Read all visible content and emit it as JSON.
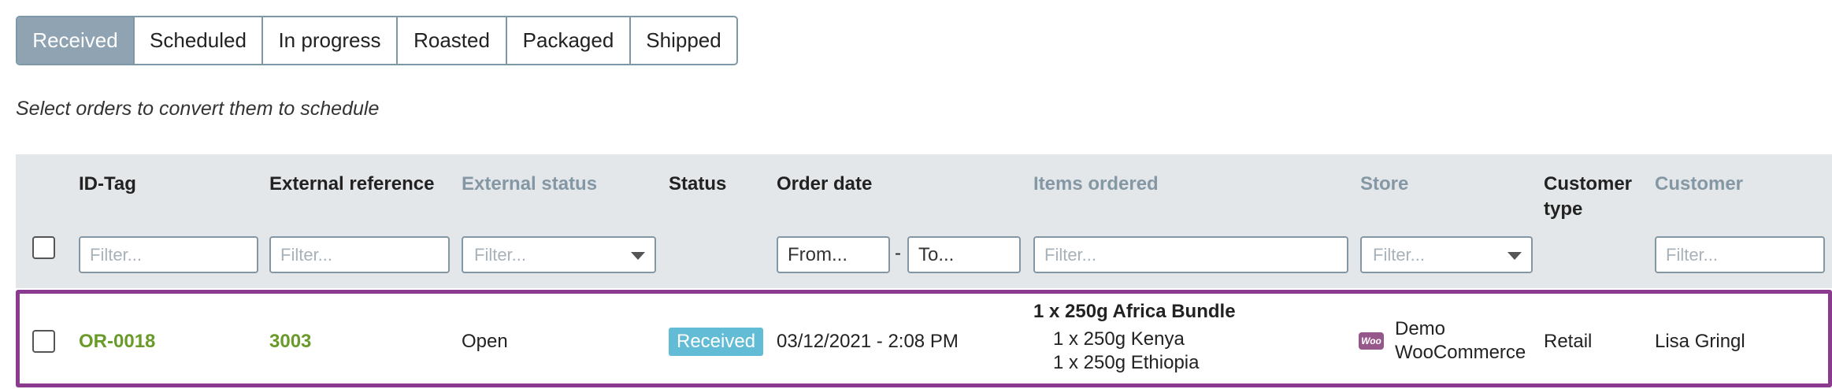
{
  "tabs": [
    {
      "label": "Received",
      "active": true
    },
    {
      "label": "Scheduled",
      "active": false
    },
    {
      "label": "In progress",
      "active": false
    },
    {
      "label": "Roasted",
      "active": false
    },
    {
      "label": "Packaged",
      "active": false
    },
    {
      "label": "Shipped",
      "active": false
    }
  ],
  "hint": "Select orders to convert them to schedule",
  "columns": {
    "id_tag": "ID-Tag",
    "external_reference": "External reference",
    "external_status": "External status",
    "status": "Status",
    "order_date": "Order date",
    "items_ordered": "Items ordered",
    "store": "Store",
    "customer_type": "Customer type",
    "customer": "Customer"
  },
  "filters": {
    "placeholder": "Filter...",
    "date_from": "From...",
    "date_to": "To...",
    "date_separator": "-"
  },
  "rows": [
    {
      "id_tag": "OR-0018",
      "external_reference": "3003",
      "external_status": "Open",
      "status": "Received",
      "order_date": "03/12/2021 - 2:08 PM",
      "items_title": "1 x 250g Africa Bundle",
      "items": [
        "1 x 250g Kenya",
        "1 x 250g Ethiopia"
      ],
      "store_icon": "woocommerce-icon",
      "store_icon_text": "Woo",
      "store": "Demo WooCommerce",
      "customer_type": "Retail",
      "customer": "Lisa Gringl"
    }
  ],
  "colors": {
    "tab_active": "#8fa3b2",
    "header_bg": "#e4e7e9",
    "link_green": "#6a9b2a",
    "status_badge": "#62bcd6",
    "row_highlight": "#8b3a8f",
    "woo_purple": "#96588a"
  }
}
